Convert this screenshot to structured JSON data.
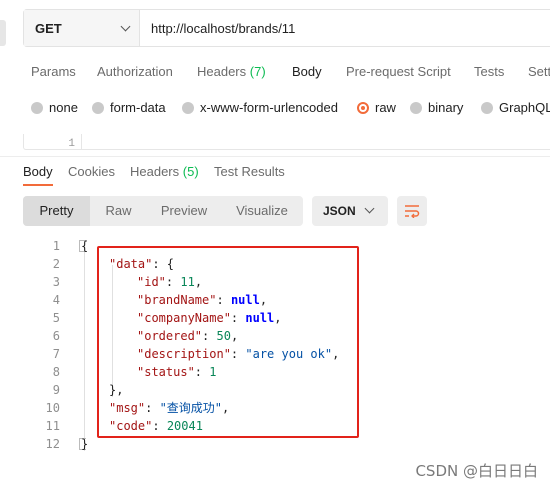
{
  "request": {
    "method": "GET",
    "url": "http://localhost/brands/11"
  },
  "request_tabs": [
    {
      "label": "Params"
    },
    {
      "label": "Authorization"
    },
    {
      "label": "Headers",
      "count": "(7)"
    },
    {
      "label": "Body"
    },
    {
      "label": "Pre-request Script"
    },
    {
      "label": "Tests"
    },
    {
      "label": "Setti"
    }
  ],
  "body_types": [
    {
      "label": "none"
    },
    {
      "label": "form-data"
    },
    {
      "label": "x-www-form-urlencoded"
    },
    {
      "label": "raw",
      "selected": true
    },
    {
      "label": "binary"
    },
    {
      "label": "GraphQL"
    }
  ],
  "request_editor": {
    "line": "1"
  },
  "response_tabs": [
    {
      "label": "Body"
    },
    {
      "label": "Cookies"
    },
    {
      "label": "Headers",
      "count": "(5)"
    },
    {
      "label": "Test Results"
    }
  ],
  "view_modes": [
    {
      "label": "Pretty"
    },
    {
      "label": "Raw"
    },
    {
      "label": "Preview"
    },
    {
      "label": "Visualize"
    }
  ],
  "format": "JSON",
  "response_lines": [
    {
      "num": "1",
      "tokens": [
        {
          "t": "br",
          "v": "{"
        }
      ]
    },
    {
      "num": "2",
      "tokens": [
        {
          "t": "k",
          "v": "\"data\""
        },
        {
          "t": "br",
          "v": ": {"
        }
      ]
    },
    {
      "num": "3",
      "tokens": [
        {
          "t": "k",
          "v": "\"id\""
        },
        {
          "t": "br",
          "v": ": "
        },
        {
          "t": "n",
          "v": "11"
        },
        {
          "t": "br",
          "v": ","
        }
      ]
    },
    {
      "num": "4",
      "tokens": [
        {
          "t": "k",
          "v": "\"brandName\""
        },
        {
          "t": "br",
          "v": ": "
        },
        {
          "t": "kw",
          "v": "null"
        },
        {
          "t": "br",
          "v": ","
        }
      ]
    },
    {
      "num": "5",
      "tokens": [
        {
          "t": "k",
          "v": "\"companyName\""
        },
        {
          "t": "br",
          "v": ": "
        },
        {
          "t": "kw",
          "v": "null"
        },
        {
          "t": "br",
          "v": ","
        }
      ]
    },
    {
      "num": "6",
      "tokens": [
        {
          "t": "k",
          "v": "\"ordered\""
        },
        {
          "t": "br",
          "v": ": "
        },
        {
          "t": "n",
          "v": "50"
        },
        {
          "t": "br",
          "v": ","
        }
      ]
    },
    {
      "num": "7",
      "tokens": [
        {
          "t": "k",
          "v": "\"description\""
        },
        {
          "t": "br",
          "v": ": "
        },
        {
          "t": "s",
          "v": "\"are you ok\""
        },
        {
          "t": "br",
          "v": ","
        }
      ]
    },
    {
      "num": "8",
      "tokens": [
        {
          "t": "k",
          "v": "\"status\""
        },
        {
          "t": "br",
          "v": ": "
        },
        {
          "t": "n",
          "v": "1"
        }
      ]
    },
    {
      "num": "9",
      "tokens": [
        {
          "t": "br",
          "v": "},"
        }
      ]
    },
    {
      "num": "10",
      "tokens": [
        {
          "t": "k",
          "v": "\"msg\""
        },
        {
          "t": "br",
          "v": ": "
        },
        {
          "t": "s",
          "v": "\"查询成功\""
        },
        {
          "t": "br",
          "v": ","
        }
      ]
    },
    {
      "num": "11",
      "tokens": [
        {
          "t": "k",
          "v": "\"code\""
        },
        {
          "t": "br",
          "v": ": "
        },
        {
          "t": "n",
          "v": "20041"
        }
      ]
    },
    {
      "num": "12",
      "tokens": [
        {
          "t": "br",
          "v": "}"
        }
      ]
    }
  ],
  "watermark": "CSDN @白日日白",
  "colors": {
    "accent": "#f26b3a",
    "highlight_border": "#e2231a",
    "count_green": "#0cbb52"
  }
}
